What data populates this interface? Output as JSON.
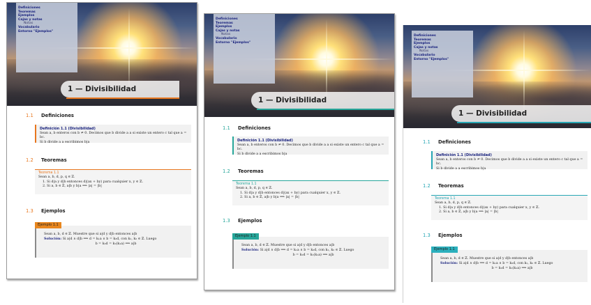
{
  "toc": {
    "items": [
      "Definiciones",
      "Teoremas",
      "Ejemplos",
      "Cajas y notas"
    ],
    "sub": "Notas",
    "items2": [
      "Vocabulario",
      "Entorno \"Ejemplos\""
    ]
  },
  "chapter": "1 — Divisibilidad",
  "sections": {
    "s1": {
      "num": "1.1",
      "title": "Definiciones"
    },
    "s2": {
      "num": "1.2",
      "title": "Teoremas"
    },
    "s3": {
      "num": "1.3",
      "title": "Ejemplos"
    }
  },
  "definition": {
    "title": "Definición 1.1 (Divisibilidad)",
    "line1": "Sean a, b enteros con b ≠ 0. Decimos que b divide a a si existe un entero c tal que a = bc.",
    "line2": "Si b divide a a escribimos b|a"
  },
  "theorem": {
    "title": "Teorema 1.1",
    "intro": "Sean a, b, d, p, q ∈ ℤ.",
    "item1": "1. Si d|a y d|b entonces d|(ax + by) para cualquier x, y ∈ ℤ.",
    "item2": "2. Si a, b ∈ ℤ, a|b y b|a ⟹ |a| = |b|"
  },
  "example": {
    "tag": "Ejemplo 1.1",
    "line1": "Sean a, b, d ∈ ℤ. Muestre que si a|d y d|b entonces a|b",
    "sol_label": "Solución:",
    "sol_text": " Si a|d ∧ d|b ⟹ d = k₁a ∧ b = k₂d, con k₁, k₂ ∈ ℤ. Luego",
    "eq": "b = k₂d = k₂(k₁a) ⟹ a|b"
  },
  "colors": {
    "variant1": "#e8761e",
    "variant2": "#26a69a",
    "variant3": "#26a6b4",
    "title_blue": "#1a237e"
  }
}
